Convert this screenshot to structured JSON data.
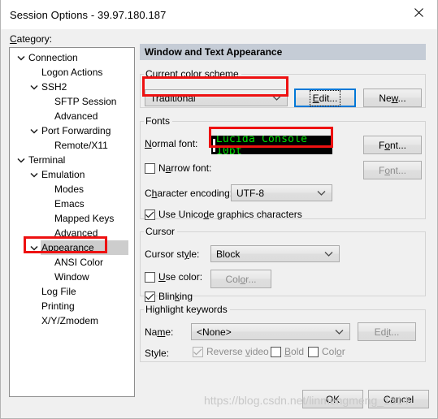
{
  "window": {
    "title": "Session Options - 39.97.180.187",
    "close_icon": "close-icon"
  },
  "category": {
    "label": "Category:",
    "items": [
      {
        "label": "Connection",
        "level": 0,
        "expandable": true,
        "selected": false
      },
      {
        "label": "Logon Actions",
        "level": 1,
        "expandable": false,
        "selected": false
      },
      {
        "label": "SSH2",
        "level": 1,
        "expandable": true,
        "selected": false
      },
      {
        "label": "SFTP Session",
        "level": 2,
        "expandable": false,
        "selected": false
      },
      {
        "label": "Advanced",
        "level": 2,
        "expandable": false,
        "selected": false
      },
      {
        "label": "Port Forwarding",
        "level": 1,
        "expandable": true,
        "selected": false
      },
      {
        "label": "Remote/X11",
        "level": 2,
        "expandable": false,
        "selected": false
      },
      {
        "label": "Terminal",
        "level": 0,
        "expandable": true,
        "selected": false
      },
      {
        "label": "Emulation",
        "level": 1,
        "expandable": true,
        "selected": false
      },
      {
        "label": "Modes",
        "level": 2,
        "expandable": false,
        "selected": false
      },
      {
        "label": "Emacs",
        "level": 2,
        "expandable": false,
        "selected": false
      },
      {
        "label": "Mapped Keys",
        "level": 2,
        "expandable": false,
        "selected": false
      },
      {
        "label": "Advanced",
        "level": 2,
        "expandable": false,
        "selected": false
      },
      {
        "label": "Appearance",
        "level": 1,
        "expandable": true,
        "selected": true
      },
      {
        "label": "ANSI Color",
        "level": 2,
        "expandable": false,
        "selected": false
      },
      {
        "label": "Window",
        "level": 2,
        "expandable": false,
        "selected": false
      },
      {
        "label": "Log File",
        "level": 1,
        "expandable": false,
        "selected": false
      },
      {
        "label": "Printing",
        "level": 1,
        "expandable": false,
        "selected": false
      },
      {
        "label": "X/Y/Zmodem",
        "level": 1,
        "expandable": false,
        "selected": false
      }
    ]
  },
  "main": {
    "header": "Window and Text Appearance",
    "color_scheme": {
      "legend": "Current color scheme",
      "value": "Traditional",
      "edit_label": "Edit...",
      "new_label": "New..."
    },
    "fonts": {
      "legend": "Fonts",
      "normal_font_label": "Normal font:",
      "normal_font_value": "Lucida Console 10pt",
      "normal_font_button": "Font...",
      "narrow_font_label": "Narrow font:",
      "narrow_font_checked": false,
      "narrow_font_button": "Font...",
      "encoding_label": "Character encoding:",
      "encoding_value": "UTF-8",
      "unicode_label": "Use Unicode graphics characters",
      "unicode_checked": true
    },
    "cursor": {
      "legend": "Cursor",
      "style_label": "Cursor style:",
      "style_value": "Block",
      "use_color_label": "Use color:",
      "use_color_checked": false,
      "color_button": "Color...",
      "blinking_label": "Blinking",
      "blinking_checked": true
    },
    "highlight": {
      "legend": "Highlight keywords",
      "name_label": "Name:",
      "name_value": "<None>",
      "edit_button": "Edit...",
      "style_label": "Style:",
      "reverse_video_label": "Reverse video",
      "reverse_video_checked": true,
      "bold_label": "Bold",
      "bold_checked": false,
      "color_label": "Color",
      "color_checked": false
    }
  },
  "footer": {
    "ok_label": "OK",
    "cancel_label": "Cancel"
  },
  "watermark": "https://blog.csdn.net/linmengmeng_1314",
  "colors": {
    "accent": "#0078d7",
    "annotation": "#ee1111",
    "header_bar": "#c5ccd6",
    "terminal_bg": "#000000",
    "terminal_fg": "#00e000"
  }
}
